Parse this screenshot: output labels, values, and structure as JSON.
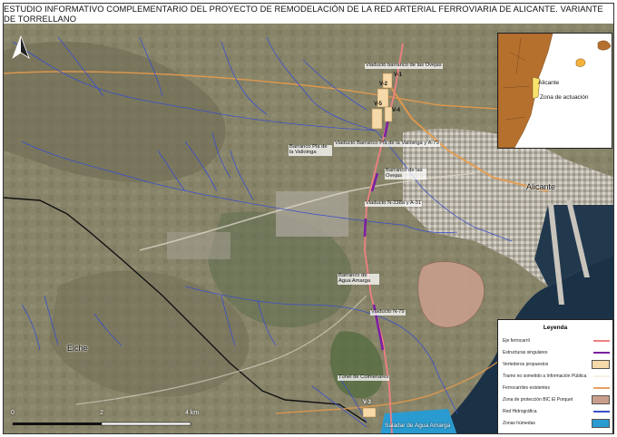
{
  "title": "ESTUDIO INFORMATIVO COMPLEMENTARIO DEL PROYECTO DE REMODELACIÓN DE LA RED ARTERIAL FERROVIARIA DE ALICANTE. VARIANTE DE TORRELLANO",
  "map_labels": {
    "viaducto_ovejas": "Viaducto barranco de las Ovejas",
    "barranco_valloinga": "Barranco Pla de la Valloinga",
    "viaducto_valloinga": "Viaducto Barranco Pla de la Valloinga y A-79",
    "barranco_ovejas": "Barranco de las Ovejas",
    "viaducto_n338": "Viaducto N-338a y A-31",
    "barranco_agua_amarga": "Barranco de Agua Amarga",
    "viaducto_n79": "Viaducto N-79",
    "tunel_colmenares": "Túnel de Colmenares",
    "saladar": "Saladar de Agua Amarga",
    "city_alicante": "Alicante",
    "city_elche": "Elche"
  },
  "vertedero_tags": [
    "V-1",
    "V-2",
    "V-4",
    "V-5",
    "V-3"
  ],
  "inset": {
    "label_alicante": "Alicante",
    "label_zona": "Zona de actuación"
  },
  "legend": {
    "title": "Leyenda",
    "items": [
      {
        "label": "Eje ferrocarril",
        "color": "#f08080",
        "kind": "line"
      },
      {
        "label": "Estructuras singulares",
        "color": "#7b1fa2",
        "kind": "line"
      },
      {
        "label": "Vertederos propuestos",
        "color": "#f5d9a8",
        "kind": "box"
      },
      {
        "label": "Tramo no sometido a Información Pública",
        "color": "#f7f1e3",
        "kind": "line"
      },
      {
        "label": "Ferrocarriles existentes",
        "color": "#e8a060",
        "kind": "line"
      },
      {
        "label": "Zona de protección BIC El Porquet",
        "color": "#c99e8c",
        "kind": "box"
      },
      {
        "label": "Red Hidrográfica",
        "color": "#3a4fc8",
        "kind": "line"
      },
      {
        "label": "Zonas húmedas",
        "color": "#2a9bd0",
        "kind": "box"
      }
    ]
  },
  "scale": {
    "labels": [
      "0",
      "2",
      "4 km"
    ]
  },
  "north_label": "N"
}
